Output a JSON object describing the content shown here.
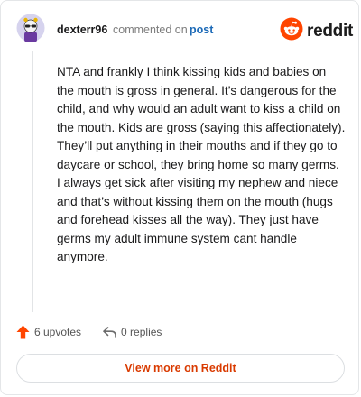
{
  "comment": {
    "username": "dexterr96",
    "action_text": "commented on",
    "target_link": "post",
    "body": "NTA and frankly I think kissing kids and babies on the mouth is gross in general. It’s dangerous for the child, and why would an adult want to kiss a child on the mouth. Kids are gross (saying this affectionately). They’ll put anything in their mouths and if they go to daycare or school, they bring home so many germs. I always get sick after visiting my nephew and niece and that’s without kissing them on the mouth (hugs and forehead kisses all the way). They just have germs my adult immune system cant handle anymore."
  },
  "brand": {
    "name": "reddit",
    "color": "#ff4500"
  },
  "actions": {
    "upvotes_label": "6 upvotes",
    "replies_label": "0 replies",
    "upvote_icon": "upvote-arrow-icon",
    "reply_icon": "reply-arrow-icon"
  },
  "footer": {
    "view_more_label": "View more on Reddit"
  },
  "colors": {
    "accent": "#ff4500",
    "link": "#1c6ab7",
    "view_more_text": "#d93a00"
  }
}
